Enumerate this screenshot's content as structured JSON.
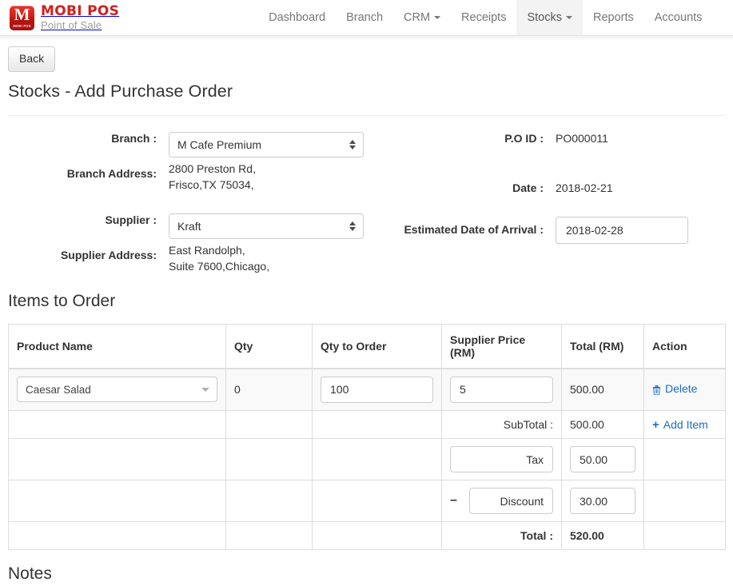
{
  "navbar": {
    "brand": {
      "title": "MOBI POS",
      "subtitle": "Point of Sale",
      "mark_letter": "M",
      "mark_sub": "MOBI POS",
      "brand_color": "#d0211c"
    },
    "links": [
      {
        "label": "Dashboard",
        "active": false,
        "caret": false
      },
      {
        "label": "Branch",
        "active": false,
        "caret": false
      },
      {
        "label": "CRM",
        "active": false,
        "caret": true
      },
      {
        "label": "Receipts",
        "active": false,
        "caret": false
      },
      {
        "label": "Stocks",
        "active": true,
        "caret": true
      },
      {
        "label": "Reports",
        "active": false,
        "caret": false
      },
      {
        "label": "Accounts",
        "active": false,
        "caret": false
      }
    ]
  },
  "toolbar": {
    "back_label": "Back"
  },
  "page": {
    "title": "Stocks - Add Purchase Order"
  },
  "form": {
    "branch_label": "Branch :",
    "branch_value": "M Cafe Premium",
    "branch_address_label": "Branch Address:",
    "branch_address_line1": "2800 Preston Rd,",
    "branch_address_line2": "Frisco,TX 75034,",
    "supplier_label": "Supplier :",
    "supplier_value": "Kraft",
    "supplier_address_label": "Supplier Address:",
    "supplier_address_line1": "East Randolph,",
    "supplier_address_line2": "Suite 7600,Chicago,",
    "po_id_label": "P.O ID :",
    "po_id_value": "PO000011",
    "date_label": "Date :",
    "date_value": "2018-02-21",
    "eta_label": "Estimated Date of Arrival :",
    "eta_value": "2018-02-28"
  },
  "items": {
    "heading": "Items to Order",
    "columns": [
      "Product Name",
      "Qty",
      "Qty to Order",
      "Supplier Price (RM)",
      "Total (RM)",
      "Action"
    ],
    "rows": [
      {
        "product": "Caesar Salad",
        "qty": "0",
        "qty_to_order": "100",
        "supplier_price": "5",
        "total": "500.00",
        "action_label": "Delete"
      }
    ],
    "subtotal_label": "SubTotal :",
    "subtotal_value": "500.00",
    "add_item_label": "Add Item",
    "tax_label": "Tax",
    "tax_value": "50.00",
    "discount_sign": "–",
    "discount_label": "Discount",
    "discount_value": "30.00",
    "total_label": "Total :",
    "total_value": "520.00",
    "link_color": "#1b6ec2"
  },
  "notes": {
    "heading": "Notes"
  }
}
